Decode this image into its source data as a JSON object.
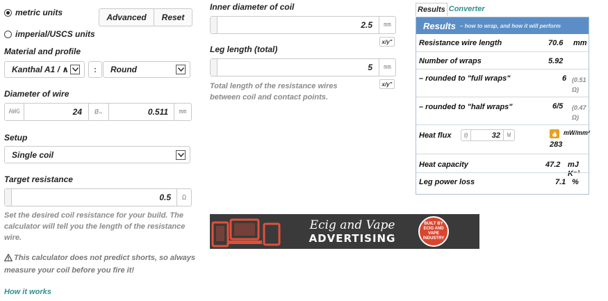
{
  "units": {
    "metric_label": "metric units",
    "imperial_label": "imperial/USCS units",
    "selected": "metric"
  },
  "toolbar": {
    "advanced_label": "Advanced",
    "reset_label": "Reset"
  },
  "material": {
    "section_label": "Material and profile",
    "material_value": "Kanthal A1 / ∧",
    "separator": ":",
    "profile_value": "Round"
  },
  "wire": {
    "section_label": "Diameter of wire",
    "gauge_unit": "AWG",
    "gauge_value": "24",
    "diameter_symbol": "Øₙ",
    "diameter_value": "0.511",
    "diameter_unit": "mm"
  },
  "setup": {
    "section_label": "Setup",
    "value": "Single coil"
  },
  "target": {
    "section_label": "Target resistance",
    "value": "0.5",
    "unit": "Ω",
    "hint": "Set the desired coil resistance for your build. The calculator will tell you the length of the resistance wire.",
    "warning": "This calculator does not predict shorts, so always measure your coil before you fire it!",
    "how_link": "How it works"
  },
  "coil": {
    "inner_label": "Inner diameter of coil",
    "inner_value": "2.5",
    "inner_unit": "mm",
    "scale_label": "x/y\"",
    "leg_label": "Leg length (total)",
    "leg_value": "5",
    "leg_unit": "mm",
    "leg_hint": "Total length of the resistance wires between coil and contact points."
  },
  "tabs": [
    {
      "label": "Results"
    },
    {
      "label": "Converter"
    }
  ],
  "results": {
    "title": "Results",
    "subtitle": "– how to wrap, and how it will perform",
    "rows": {
      "wire_length": {
        "label": "Resistance wire length",
        "value": "70.6",
        "unit": "mm"
      },
      "wraps": {
        "label": "Number of wraps",
        "value": "5.92"
      },
      "full": {
        "label": "– rounded to \"full wraps\"",
        "value": "6",
        "ohm": "(0.51 Ω)"
      },
      "half": {
        "label": "– rounded to \"half wraps\"",
        "value": "6/5",
        "ohm": "(0.47 Ω)"
      },
      "heat_flux": {
        "label": "Heat flux",
        "at": "@",
        "watts": "32",
        "w_unit": "W",
        "value": "283",
        "unit": "mW/mm²"
      },
      "heat_capacity": {
        "label": "Heat capacity",
        "value": "47.2",
        "unit": "mJ K⁻¹"
      },
      "leg_loss": {
        "label": "Leg power loss",
        "value": "7.1",
        "unit": "%"
      }
    }
  },
  "ad": {
    "line1": "Ecig and Vape",
    "line2": "ADVERTISING",
    "badge": "BUILT BY ECIG AND VAPE INDUSTRY"
  },
  "colors": {
    "accent": "#5b8ec6",
    "link": "#2f8f8f",
    "hint": "#8a8a8a",
    "flame": "#e8a020"
  }
}
